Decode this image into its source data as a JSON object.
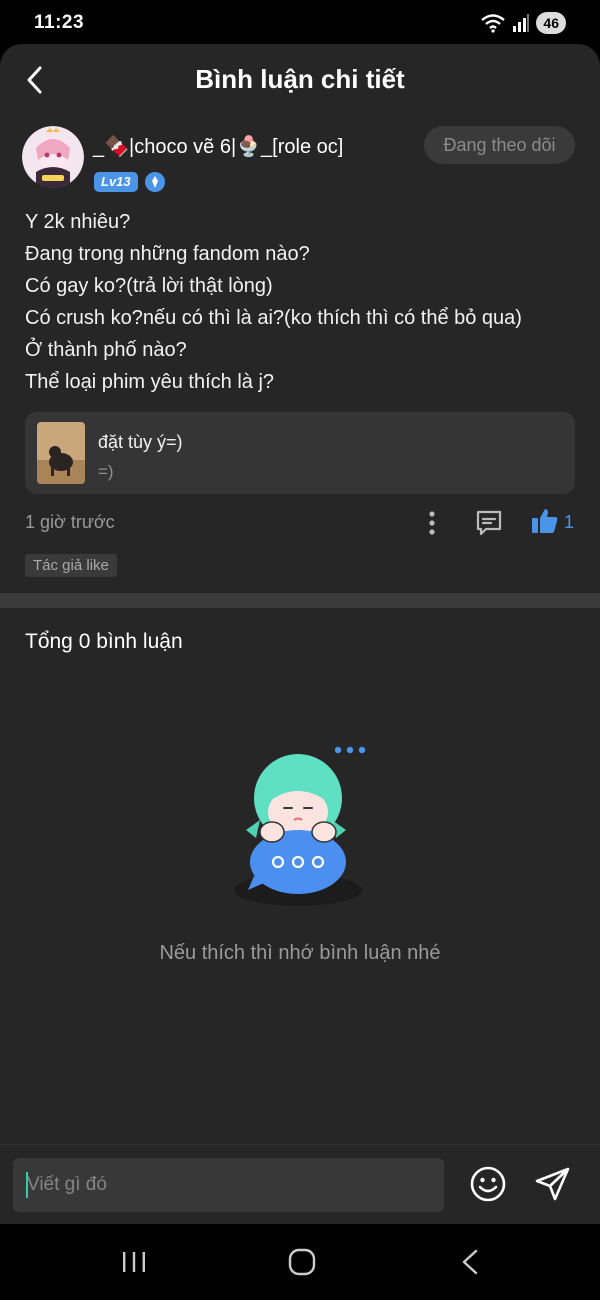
{
  "status_bar": {
    "time": "11:23",
    "battery": "46"
  },
  "header": {
    "title": "Bình luận chi tiết"
  },
  "post": {
    "author_name": "_🍫|choco vẽ 6|🍨_[role oc]",
    "level": "Lv13",
    "follow_label": "Đang theo dõi",
    "lines": [
      "Y 2k nhiêu?",
      "Đang trong những fandom nào?",
      "Có gay ko?(trả lời thật lòng)",
      "Có crush ko?nếu có thì là ai?(ko thích thì có thể bỏ qua)",
      "Ở thành phố nào?",
      "Thể loại phim yêu thích là j?"
    ],
    "linked_card": {
      "title": "đặt tùy ý=)",
      "subtitle": "=)"
    },
    "time_ago": "1 giờ trước",
    "like_count": "1",
    "author_liked": "Tác giả like"
  },
  "comments": {
    "total_label": "Tổng 0 bình luận",
    "empty_text": "Nếu thích thì nhớ bình luận nhé"
  },
  "input": {
    "placeholder": "Viết gì đó"
  },
  "colors": {
    "accent": "#4b95e9",
    "background": "#262626",
    "card": "#353535"
  }
}
